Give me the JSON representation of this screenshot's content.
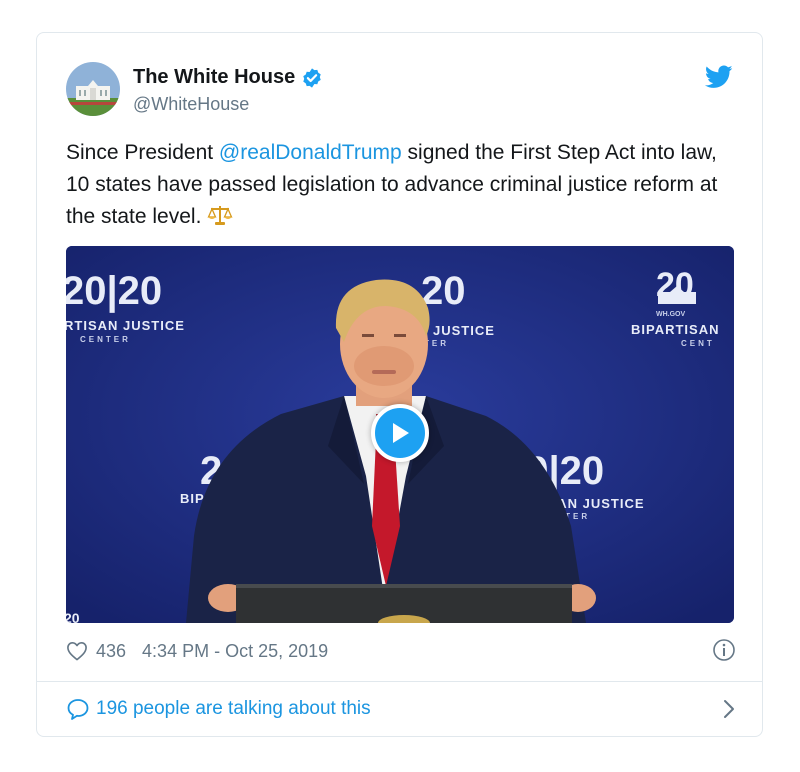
{
  "account": {
    "display_name": "The White House",
    "handle": "@WhiteHouse",
    "verified": true
  },
  "tweet": {
    "text_before": "Since President ",
    "mention": "@realDonaldTrump",
    "text_after": " signed the First Step Act into law, 10 states have passed legislation to advance criminal justice reform at the state level.",
    "emoji": "scales-icon"
  },
  "video": {
    "backdrop_texts": {
      "top_left_year": "20|20",
      "top_left_label": "RTISAN JUSTICE",
      "top_left_sub": "CENTER",
      "top_center_year": "20",
      "top_center_label": "N JUSTICE",
      "top_center_sub": "TER",
      "top_right_year": "20",
      "top_right_label": "BIPARTISAN",
      "top_right_sub": "CENT",
      "top_right_logo": "WH.GOV",
      "mid_left_year": "2",
      "mid_left_label": "BIP",
      "mid_right_year": "20|20",
      "mid_right_label": "TISAN JUSTICE",
      "mid_right_sub": "ENTER"
    },
    "has_play_button": true
  },
  "footer": {
    "likes": "436",
    "timestamp": "4:34 PM - Oct 25, 2019"
  },
  "conversation": {
    "label": "196 people are talking about this"
  },
  "colors": {
    "link": "#1b95e0",
    "twitter_blue": "#1da1f2",
    "muted": "#657786",
    "border": "#e1e8ed",
    "video_bg": "#1c2a7e"
  }
}
